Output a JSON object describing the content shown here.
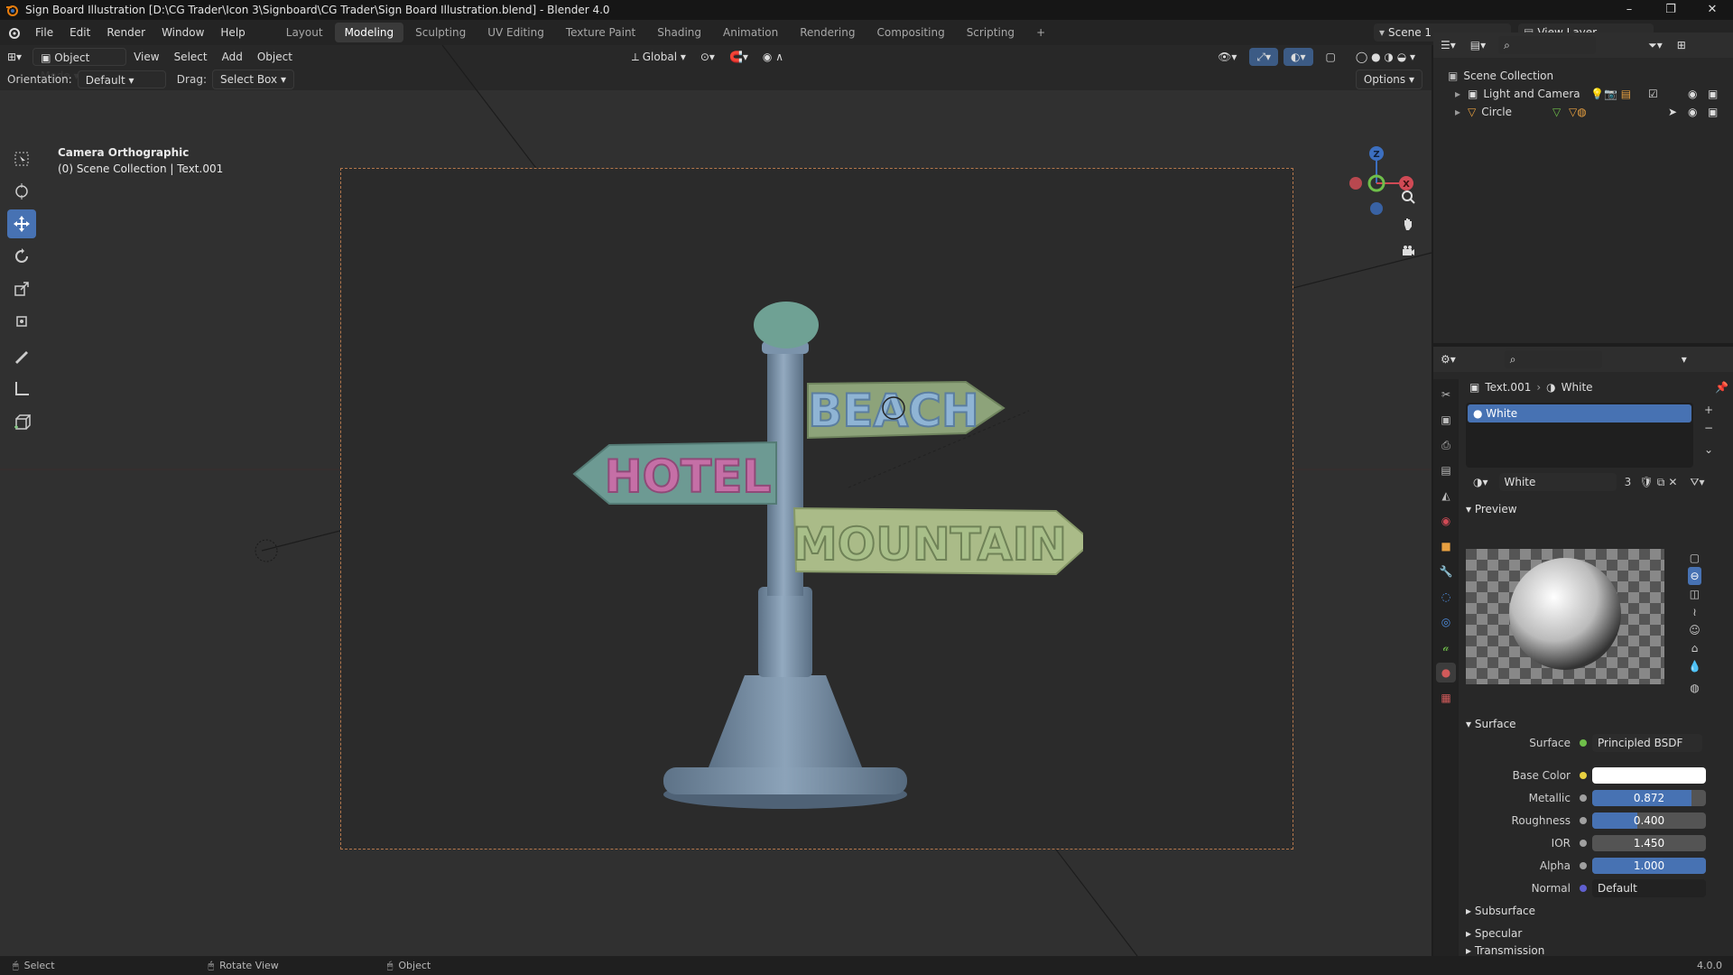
{
  "window": {
    "title": "Sign Board Illustration [D:\\CG Trader\\Icon 3\\Signboard\\CG Trader\\Sign Board Illustration.blend] - Blender 4.0",
    "controls": [
      "–",
      "❐",
      "✕"
    ]
  },
  "menu": {
    "items": [
      "File",
      "Edit",
      "Render",
      "Window",
      "Help"
    ],
    "workspaces": [
      "Layout",
      "Modeling",
      "Sculpting",
      "UV Editing",
      "Texture Paint",
      "Shading",
      "Animation",
      "Rendering",
      "Compositing",
      "Scripting"
    ],
    "active_workspace": "Modeling",
    "add_tab": "+",
    "scene": "Scene 1",
    "view_layer": "View Layer"
  },
  "viewport": {
    "mode": "Object Mode",
    "menus": [
      "View",
      "Select",
      "Add",
      "Object"
    ],
    "transform_orientation": "Global",
    "orientation_label": "Orientation:",
    "orientation_value": "Default",
    "drag_label": "Drag:",
    "drag_value": "Select Box",
    "options": "Options",
    "camera_label": "Camera Orthographic",
    "collection_label": "(0) Scene Collection | Text.001",
    "gizmo_axes": {
      "z": "Z",
      "y": "Y",
      "x": "X"
    },
    "signs": {
      "beach": "BEACH",
      "hotel": "HOTEL",
      "mountain": "MOUNTAIN"
    },
    "colors": {
      "pole": "#7b93ab",
      "beach_board": "#8da37a",
      "beach_text": "#8fb4d4",
      "hotel_board": "#6d9a93",
      "hotel_text": "#c56fa6",
      "mountain_board": "#aabb88",
      "mountain_text": "#a8bf89",
      "knob": "#6fa194"
    }
  },
  "outliner": {
    "root": "Scene Collection",
    "items": [
      {
        "label": "Light and Camera",
        "icon": "collection-icon"
      },
      {
        "label": "Circle",
        "icon": "mesh-object-icon"
      }
    ]
  },
  "properties": {
    "breadcrumb_object": "Text.001",
    "breadcrumb_material": "White",
    "slot_name": "White",
    "material_name": "White",
    "users": "3",
    "preview_title": "Preview",
    "surface_title": "Surface",
    "rows": {
      "surface": {
        "label": "Surface",
        "value": "Principled BSDF"
      },
      "base_color": {
        "label": "Base Color",
        "color": "#ffffff"
      },
      "metallic": {
        "label": "Metallic",
        "value": "0.872",
        "fraction": 0.872
      },
      "roughness": {
        "label": "Roughness",
        "value": "0.400",
        "fraction": 0.4
      },
      "ior": {
        "label": "IOR",
        "value": "1.450",
        "fraction": 0.0
      },
      "alpha": {
        "label": "Alpha",
        "value": "1.000",
        "fraction": 1.0
      },
      "normal": {
        "label": "Normal",
        "value": "Default"
      }
    },
    "subpanels": [
      "Subsurface",
      "Specular",
      "Transmission"
    ]
  },
  "statusbar": {
    "items": [
      "Select",
      "Rotate View",
      "Object"
    ],
    "version": "4.0.0"
  }
}
